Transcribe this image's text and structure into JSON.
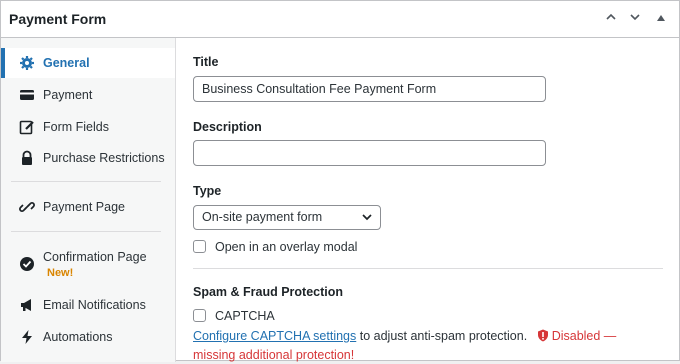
{
  "header": {
    "title": "Payment Form",
    "controls": [
      "chevron-up-icon",
      "chevron-down-icon",
      "triangle-up-icon"
    ]
  },
  "sidebar": {
    "items": [
      {
        "label": "General",
        "icon": "gear-icon",
        "active": true
      },
      {
        "label": "Payment",
        "icon": "card-icon"
      },
      {
        "label": "Form Fields",
        "icon": "edit-icon"
      },
      {
        "label": "Purchase Restrictions",
        "icon": "lock-icon"
      },
      {
        "label": "Payment Page",
        "icon": "link-icon"
      },
      {
        "label": "Confirmation Page",
        "icon": "check-circle-icon",
        "badge": "New!"
      },
      {
        "label": "Email Notifications",
        "icon": "megaphone-icon"
      },
      {
        "label": "Automations",
        "icon": "bolt-icon"
      }
    ]
  },
  "form": {
    "title_label": "Title",
    "title_value": "Business Consultation Fee Payment Form",
    "description_label": "Description",
    "description_value": "",
    "type_label": "Type",
    "type_value": "On-site payment form",
    "overlay_label": "Open in an overlay modal",
    "spam_heading": "Spam & Fraud Protection",
    "captcha_label": "CAPTCHA",
    "help_link": "Configure CAPTCHA settings",
    "help_text": " to adjust anti-spam protection.",
    "warning_text": "Disabled — missing additional protection!"
  },
  "colors": {
    "accent": "#2271b1",
    "warning": "#d63638",
    "badge": "#d98500"
  }
}
